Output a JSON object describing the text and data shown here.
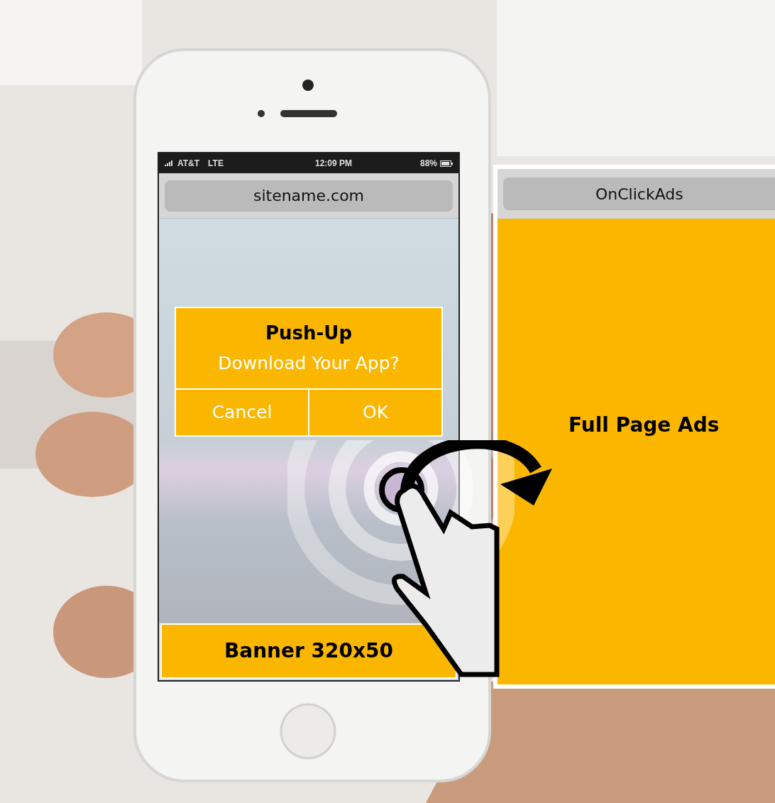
{
  "status_bar": {
    "carrier": "AT&T",
    "network": "LTE",
    "time": "12:09 PM",
    "battery": "88%"
  },
  "address_bar": {
    "url": "sitename.com"
  },
  "push_up": {
    "title": "Push-Up",
    "message": "Download Your App?",
    "buttons": [
      "Cancel",
      "OK"
    ]
  },
  "banner": {
    "label": "Banner 320x50"
  },
  "full_page_ad": {
    "header": "OnClickAds",
    "label": "Full Page Ads"
  }
}
